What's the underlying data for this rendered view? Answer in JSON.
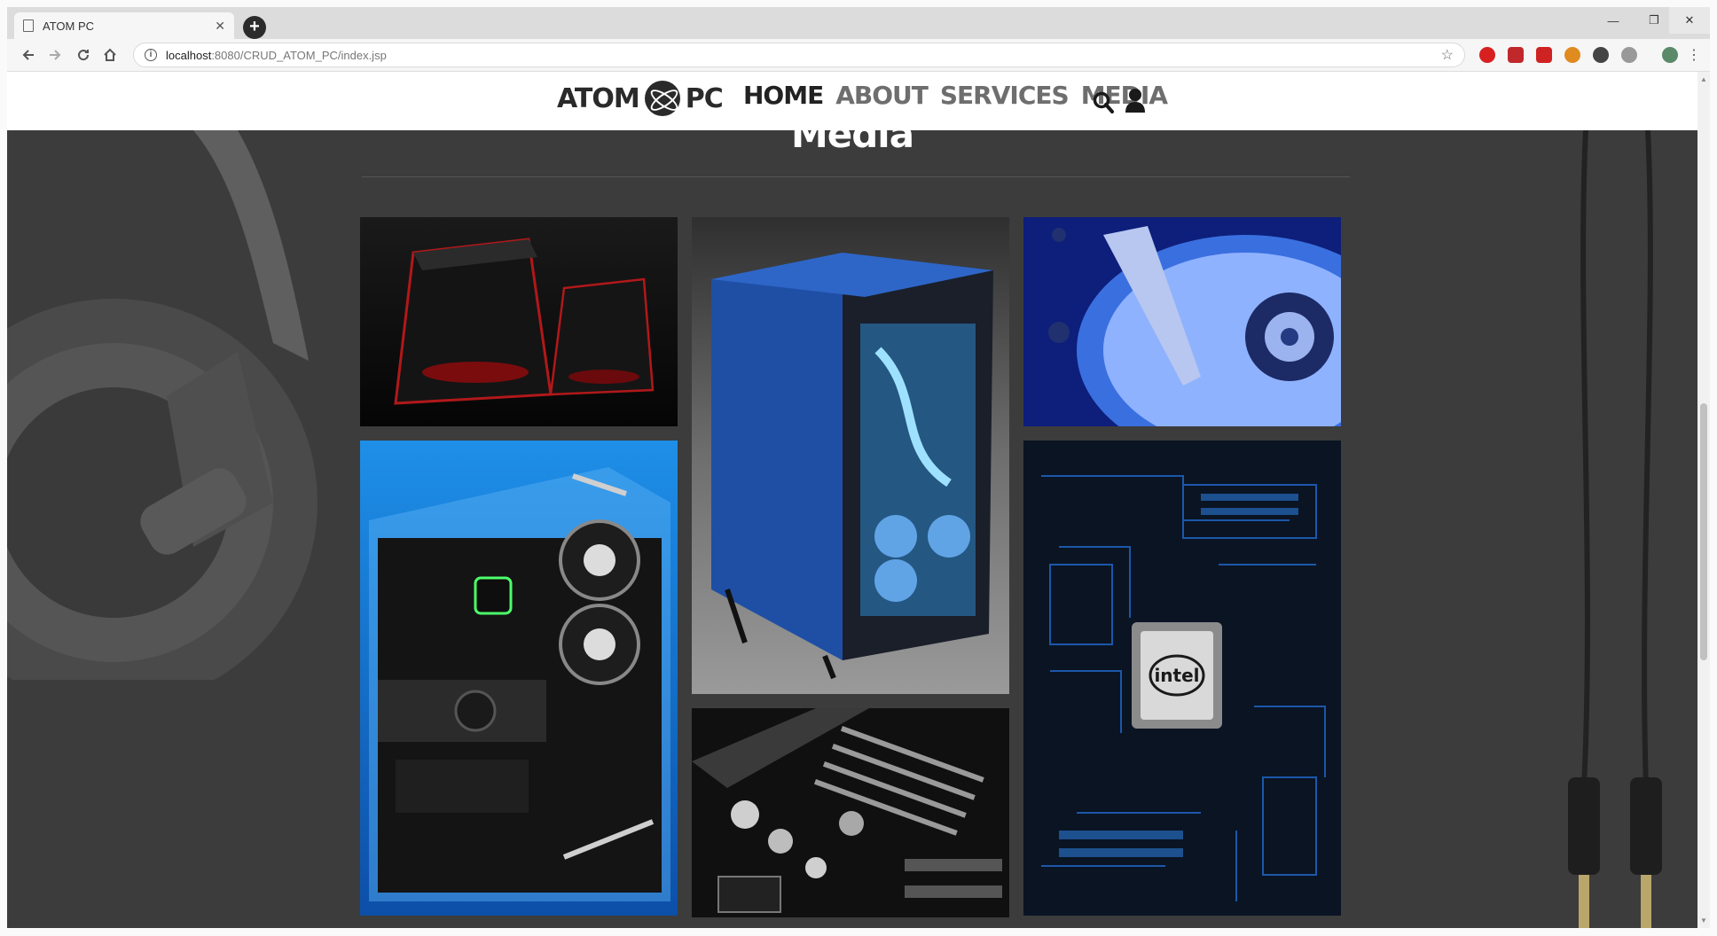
{
  "browser": {
    "tab_title": "ATOM PC",
    "tab_close": "✕",
    "new_tab": "+",
    "url_host": "localhost",
    "url_rest": ":8080/CRUD_ATOM_PC/index.jsp",
    "window_controls": [
      "—",
      "❐",
      "✕"
    ]
  },
  "site": {
    "logo_left": "ATOM",
    "logo_right": "PC",
    "nav": [
      {
        "label": "HOME",
        "active": true
      },
      {
        "label": "ABOUT",
        "active": false
      },
      {
        "label": "SERVICES",
        "active": false
      },
      {
        "label": "MEDIA",
        "active": false
      }
    ]
  },
  "section": {
    "title": "Media"
  },
  "gallery": [
    {
      "name": "gaming-pc-towers-image",
      "icon": "pc-tower-red"
    },
    {
      "name": "blue-liquid-cooled-case-image",
      "icon": "pc-case-blue"
    },
    {
      "name": "hard-drive-platter-image",
      "icon": "hard-drive"
    },
    {
      "name": "open-frame-build-image",
      "icon": "open-frame-pc"
    },
    {
      "name": "intel-cpu-motherboard-image",
      "icon": "cpu-board",
      "text": "intel"
    },
    {
      "name": "motherboard-closeup-image",
      "icon": "motherboard"
    }
  ],
  "colors": {
    "page_bg": "#3c3c3c",
    "header_bg": "#ffffff",
    "nav_active": "#222222",
    "nav_inactive": "#6e6e6e",
    "accent_blue": "#1e6fd9"
  }
}
